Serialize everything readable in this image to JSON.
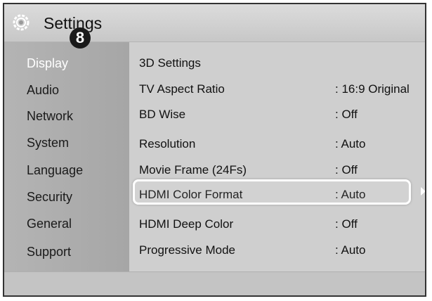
{
  "window": {
    "title": "Settings",
    "marker": "8"
  },
  "sidebar": {
    "items": [
      {
        "label": "Display",
        "active": true
      },
      {
        "label": "Audio"
      },
      {
        "label": "Network"
      },
      {
        "label": "System"
      },
      {
        "label": "Language"
      },
      {
        "label": "Security"
      },
      {
        "label": "General"
      },
      {
        "label": "Support"
      }
    ]
  },
  "main": {
    "rows": [
      {
        "label": "3D Settings",
        "value": ""
      },
      {
        "label": "TV Aspect Ratio",
        "value": ": 16:9 Original"
      },
      {
        "label": "BD Wise",
        "value": ": Off"
      },
      {
        "label": "Resolution",
        "value": ": Auto"
      },
      {
        "label": "Movie Frame (24Fs)",
        "value": ": Off"
      },
      {
        "label": "HDMI Color Format",
        "value": ": Auto",
        "selected": true
      },
      {
        "label": "HDMI Deep Color",
        "value": ": Off"
      },
      {
        "label": "Progressive Mode",
        "value": ": Auto"
      }
    ]
  },
  "icons": {
    "settings": "gear-icon",
    "next": "chevron-right-icon"
  },
  "colors": {
    "highlight": "#ffffff",
    "active_item": "#ffffff"
  }
}
